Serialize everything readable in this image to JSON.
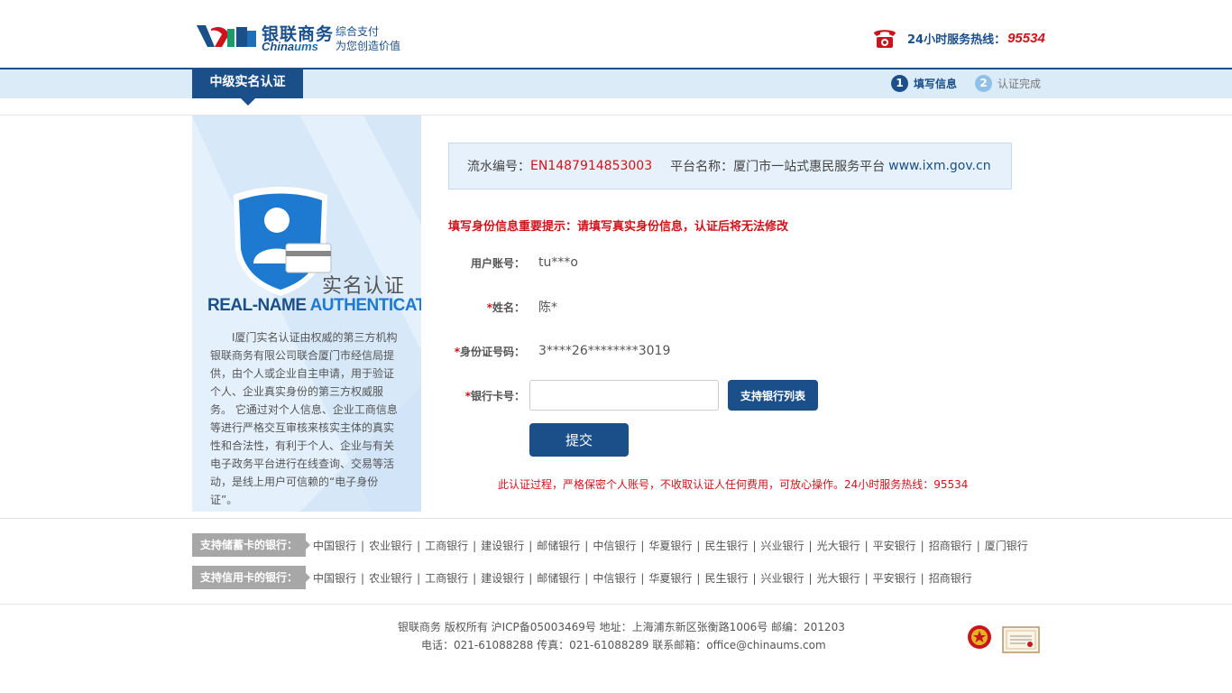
{
  "header": {
    "brand_cn": "银联商务",
    "brand_en_prefix": "China",
    "brand_en_suffix": "ums",
    "slogan_line1": "综合支付",
    "slogan_line2": "为您创造价值",
    "hotline_label": "24小时服务热线：",
    "hotline_number": "95534"
  },
  "nav": {
    "tab_label": "中级实名认证",
    "steps": [
      {
        "num": "1",
        "label": "填写信息"
      },
      {
        "num": "2",
        "label": "认证完成"
      }
    ]
  },
  "sidebar": {
    "auth_cn": "实名认证",
    "auth_en_part1": "REAL-NAME ",
    "auth_en_part2": "AUTHENTICATION",
    "description": "I厦门实名认证由权威的第三方机构银联商务有限公司联合厦门市经信局提供，由个人或企业自主申请，用于验证个人、企业真实身份的第三方权威服务。 它通过对个人信息、企业工商信息等进行严格交互审核来核实主体的真实性和合法性，有利于个人、企业与有关电子政务平台进行在线查询、交易等活动，是线上用户可信赖的“电子身份证”。"
  },
  "info": {
    "serial_label": "流水编号：",
    "serial_value": "EN1487914853003",
    "platform_label": "平台名称：厦门市一站式惠民服务平台",
    "platform_url": "www.ixm.gov.cn"
  },
  "form": {
    "warning": "填写身份信息重要提示：请填写真实身份信息，认证后将无法修改",
    "username_label": "用户账号：",
    "username_value": "tu***o",
    "name_label": "姓名：",
    "name_value": "陈*",
    "id_label": "身份证号码：",
    "id_value": "3****26********3019",
    "card_label": "银行卡号：",
    "card_value": "",
    "card_placeholder": "",
    "bank_list_button": "支持银行列表",
    "submit_button": "提交",
    "notice": "此认证过程，严格保密个人账号，不收取认证人任何费用，可放心操作。24小时服务热线：95534"
  },
  "banks": {
    "debit_label": "支持储蓄卡的银行：",
    "debit": [
      "中国银行",
      "农业银行",
      "工商银行",
      "建设银行",
      "邮储银行",
      "中信银行",
      "华夏银行",
      "民生银行",
      "兴业银行",
      "光大银行",
      "平安银行",
      "招商银行",
      "厦门银行"
    ],
    "credit_label": "支持信用卡的银行：",
    "credit": [
      "中国银行",
      "农业银行",
      "工商银行",
      "建设银行",
      "邮储银行",
      "中信银行",
      "华夏银行",
      "民生银行",
      "兴业银行",
      "光大银行",
      "平安银行",
      "招商银行"
    ]
  },
  "footer": {
    "line1": "银联商务 版权所有 沪ICP备05003469号 地址：上海浦东新区张衡路1006号 邮编：201203",
    "line2": "电话：021-61088288 传真：021-61088289 联系邮箱：office@chinaums.com"
  },
  "colors": {
    "brand_blue": "#1b4f8a",
    "alert_red": "#d0121b",
    "light_blue_band": "#dcebf8"
  }
}
